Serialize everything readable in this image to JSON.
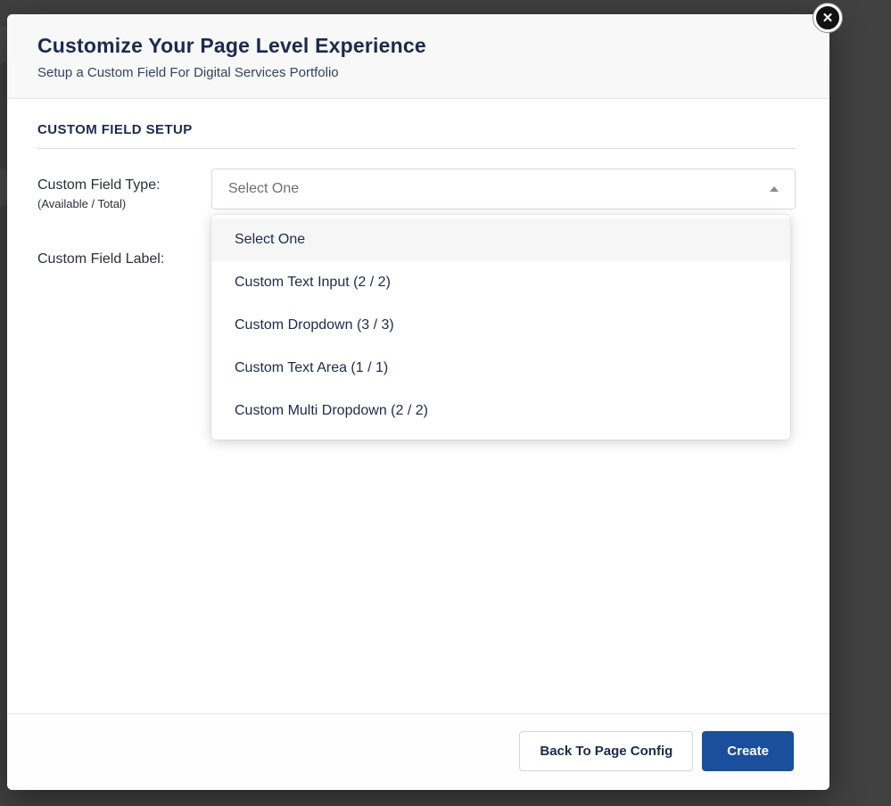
{
  "modal": {
    "close_icon": "✕",
    "header": {
      "title": "Customize Your Page Level Experience",
      "subtitle": "Setup a Custom Field For Digital Services Portfolio"
    },
    "body": {
      "section_title": "CUSTOM FIELD SETUP",
      "field_type_label": "Custom Field Type:",
      "field_type_sublabel": "(Available / Total)",
      "field_label_label": "Custom Field Label:",
      "select_value": "Select One",
      "options": [
        {
          "label": "Select One"
        },
        {
          "label": "Custom Text Input (2 / 2)"
        },
        {
          "label": "Custom Dropdown (3 / 3)"
        },
        {
          "label": "Custom Text Area (1 / 1)"
        },
        {
          "label": "Custom Multi Dropdown (2 / 2)"
        }
      ]
    },
    "footer": {
      "back_label": "Back To Page Config",
      "create_label": "Create"
    }
  },
  "colors": {
    "accent_blue": "#1a4f9e",
    "title_navy": "#1b2a4e",
    "overlay": "#414141"
  }
}
